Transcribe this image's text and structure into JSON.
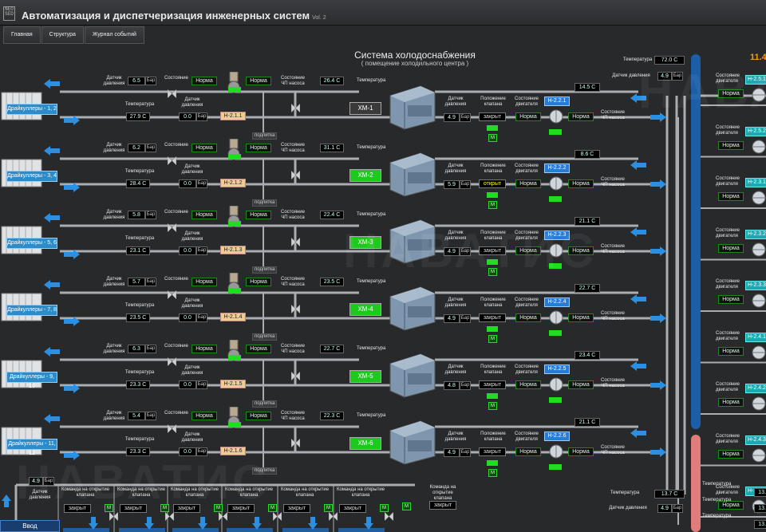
{
  "header": {
    "logo": "NEO SED",
    "title": "Автоматизация и диспетчеризация инженерных систем",
    "version": "Vol. 2"
  },
  "nav": [
    "Главная",
    "Структура",
    "Журнал событий"
  ],
  "system": {
    "title": "Система холодоснабжения",
    "subtitle": "( помещение холодильного центра )"
  },
  "labels": {
    "sensor_pressure": "Датчик давления",
    "state": "Состояние",
    "temperature": "Температура",
    "pump_state": "Состояние ЧП насоса",
    "valve_pos": "Положение клапана",
    "motor_state": "Состояние двигателя",
    "podpitka": "подпитка",
    "unit_bar": "Бар",
    "status_norm": "Норма",
    "closed": "закрыт",
    "open": "открыт",
    "cmd_open": "Команда на открытие клапана",
    "m": "М"
  },
  "rows": [
    {
      "dry": "Драйкуллеры - 1, 2",
      "p_in": "6.5",
      "p_out": "0.0",
      "t_in": "27.9 С",
      "pump": "Н-2.1.1",
      "t_hot": "26.4 С",
      "hm": "ХМ-1",
      "hm_on": false,
      "p_hm": "4.9",
      "valve": "закрыт",
      "valve_open": false,
      "h2": "Н-2.2.1",
      "t_ret": "14.5 С"
    },
    {
      "dry": "Драйкуллеры - 3, 4",
      "p_in": "6.2",
      "p_out": "0.0",
      "t_in": "28.4 С",
      "pump": "Н-2.1.2",
      "t_hot": "31.1 С",
      "hm": "ХМ-2",
      "hm_on": true,
      "p_hm": "5.9",
      "valve": "открыт",
      "valve_open": true,
      "h2": "Н-2.2.2",
      "t_ret": "8.6 С"
    },
    {
      "dry": "Драйкуллеры - 5, 6",
      "p_in": "5.8",
      "p_out": "0.0",
      "t_in": "23.1 С",
      "pump": "Н-2.1.3",
      "t_hot": "22.4 С",
      "hm": "ХМ-3",
      "hm_on": true,
      "p_hm": "4.9",
      "valve": "закрыт",
      "valve_open": false,
      "h2": "Н-2.2.3",
      "t_ret": "21.1 С"
    },
    {
      "dry": "Драйкуллеры - 7, 8",
      "p_in": "5.7",
      "p_out": "0.0",
      "t_in": "23.5 С",
      "pump": "Н-2.1.4",
      "t_hot": "23.5 С",
      "hm": "ХМ-4",
      "hm_on": true,
      "p_hm": "4.9",
      "valve": "закрыт",
      "valve_open": false,
      "h2": "Н-2.2.4",
      "t_ret": "22.7 С"
    },
    {
      "dry": "Драйкуллеры - 9, 10",
      "p_in": "6.3",
      "p_out": "0.0",
      "t_in": "23.3 С",
      "pump": "Н-2.1.5",
      "t_hot": "22.7 С",
      "hm": "ХМ-5",
      "hm_on": true,
      "p_hm": "4.8",
      "valve": "закрыт",
      "valve_open": false,
      "h2": "Н-2.2.5",
      "t_ret": "23.4 С"
    },
    {
      "dry": "Драйкуллеры - 11, 12",
      "p_in": "5.4",
      "p_out": "0.0",
      "t_in": "23.3 С",
      "pump": "Н-2.1.6",
      "t_hot": "22.3 С",
      "hm": "ХМ-6",
      "hm_on": true,
      "p_hm": "4.9",
      "valve": "закрыт",
      "valve_open": false,
      "h2": "Н-2.2.6",
      "t_ret": "21.1 С"
    }
  ],
  "right": {
    "t_top": "72.0 С",
    "p_top": "4.9",
    "big": "11.4",
    "t_bottom": "13.7 С",
    "p_bottom": "4.9"
  },
  "right_pumps": [
    "Н-2.5.1",
    "Н-2.5.2",
    "Н-2.3.1",
    "Н-2.3.2",
    "Н-2.3.3",
    "Н-2.4.1",
    "Н-2.4.2",
    "Н-2.4.3",
    "Н-2.4.4"
  ],
  "right_bottom_vals": [
    "13.7",
    "13.7",
    "13.7"
  ],
  "bottom": {
    "p_value": "4.9",
    "valves": [
      "закрыт",
      "закрыт",
      "закрыт",
      "закрыт",
      "закрыт",
      "закрыт"
    ],
    "extra_valve": "закрыт",
    "vvod": "Ввод"
  },
  "watermark": "НАВАТИС"
}
